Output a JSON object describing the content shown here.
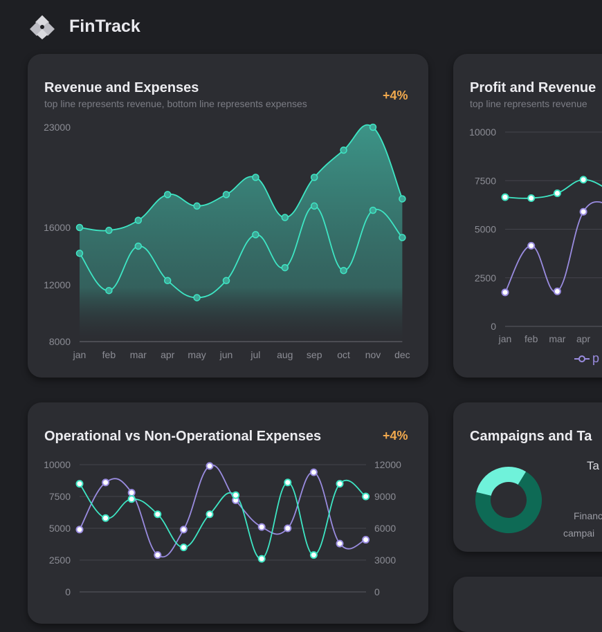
{
  "app": {
    "name": "FinTrack"
  },
  "colors": {
    "background": "#1e1f23",
    "card": "#2c2d32",
    "accent": "#3ee6c4",
    "purple": "#9a8ce0",
    "badge": "#f1a94e",
    "donut_dark": "#0e6a55",
    "donut_light": "#6ff2da"
  },
  "cards": {
    "revenue": {
      "title": "Revenue and Expenses",
      "subtitle": "top line represents revenue, bottom line represents expenses",
      "badge": "+4%"
    },
    "profit": {
      "title": "Profit and Revenue",
      "subtitle": "top line represents revenue",
      "legend_label": "p"
    },
    "operational": {
      "title": "Operational vs Non-Operational Expenses",
      "badge": "+4%"
    },
    "campaigns": {
      "title": "Campaigns and Ta",
      "label_top": "Ta",
      "label_bottom_1": "Financ",
      "label_bottom_2": "campai"
    }
  },
  "chart_data": [
    {
      "type": "area",
      "categories": [
        "jan",
        "feb",
        "mar",
        "apr",
        "may",
        "jun",
        "jul",
        "aug",
        "sep",
        "oct",
        "nov",
        "dec"
      ],
      "y_ticks": [
        "23000",
        "16000",
        "12000",
        "8000"
      ],
      "series": [
        {
          "values": [
            16000,
            15800,
            16500,
            18300,
            17500,
            18300,
            19500,
            16700,
            19500,
            21400,
            23000,
            18000
          ]
        },
        {
          "values": [
            14200,
            11600,
            14700,
            12300,
            11100,
            12300,
            15500,
            13200,
            17500,
            13000,
            17200,
            15300
          ]
        }
      ]
    },
    {
      "type": "line",
      "categories": [
        "jan",
        "feb",
        "mar",
        "apr"
      ],
      "y_ticks": [
        "10000",
        "7500",
        "5000",
        "2500",
        "0"
      ],
      "ylim": [
        0,
        10000
      ],
      "series": [
        {
          "values": [
            6650,
            6600,
            6850,
            7550
          ]
        },
        {
          "values": [
            1750,
            4150,
            1800,
            5900
          ]
        }
      ]
    },
    {
      "type": "line",
      "categories": [
        "jan",
        "feb",
        "mar",
        "apr",
        "may",
        "jun",
        "jul",
        "aug",
        "sep",
        "oct",
        "nov",
        "dec"
      ],
      "y_ticks_left": [
        "10000",
        "7500",
        "5000",
        "2500",
        "0"
      ],
      "y_ticks_right": [
        "12000",
        "9000",
        "6000",
        "3000",
        "0"
      ],
      "ylim_left": [
        0,
        10000
      ],
      "ylim_right": [
        0,
        12000
      ],
      "series": [
        {
          "axis": "left",
          "values": [
            8500,
            5800,
            7300,
            6100,
            3500,
            6100,
            7600,
            2600,
            8600,
            2900,
            8500,
            7500
          ]
        },
        {
          "axis": "left",
          "values": [
            4900,
            8600,
            7800,
            2900,
            4900,
            9900,
            7200,
            5100,
            5000,
            9400,
            3800,
            4100
          ]
        }
      ]
    },
    {
      "type": "pie",
      "values": [
        70,
        30
      ]
    }
  ]
}
